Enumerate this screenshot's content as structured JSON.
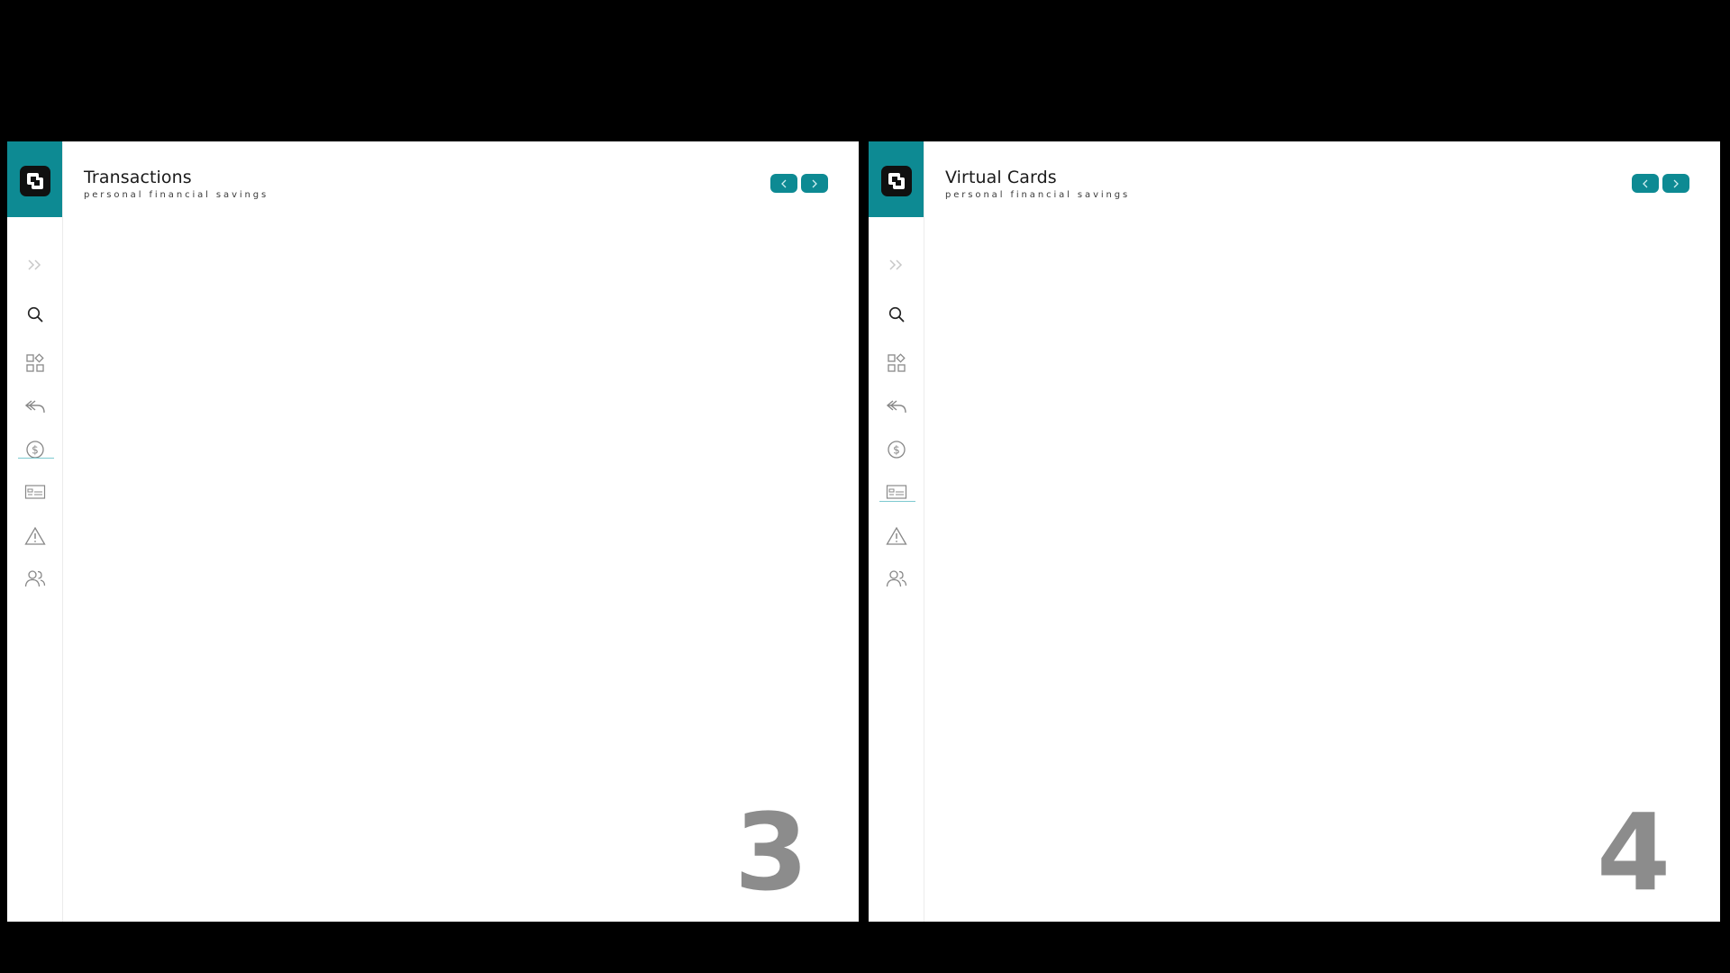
{
  "subtitle": "personal financial savings",
  "colors": {
    "accent": "#0d8a93",
    "background": "#000000",
    "page_number": "#8c8c8c"
  },
  "sidebar_icons": [
    "expand-icon",
    "search-icon",
    "dashboard-icon",
    "reply-icon",
    "dollar-icon",
    "card-icon",
    "warning-icon",
    "users-icon"
  ],
  "panels": [
    {
      "title": "Transactions",
      "subtitle": "personal financial savings",
      "page_number": "3",
      "active_item": "dollar-icon"
    },
    {
      "title": "Virtual Cards",
      "subtitle": "personal financial savings",
      "page_number": "4",
      "active_item": "card-icon"
    }
  ]
}
